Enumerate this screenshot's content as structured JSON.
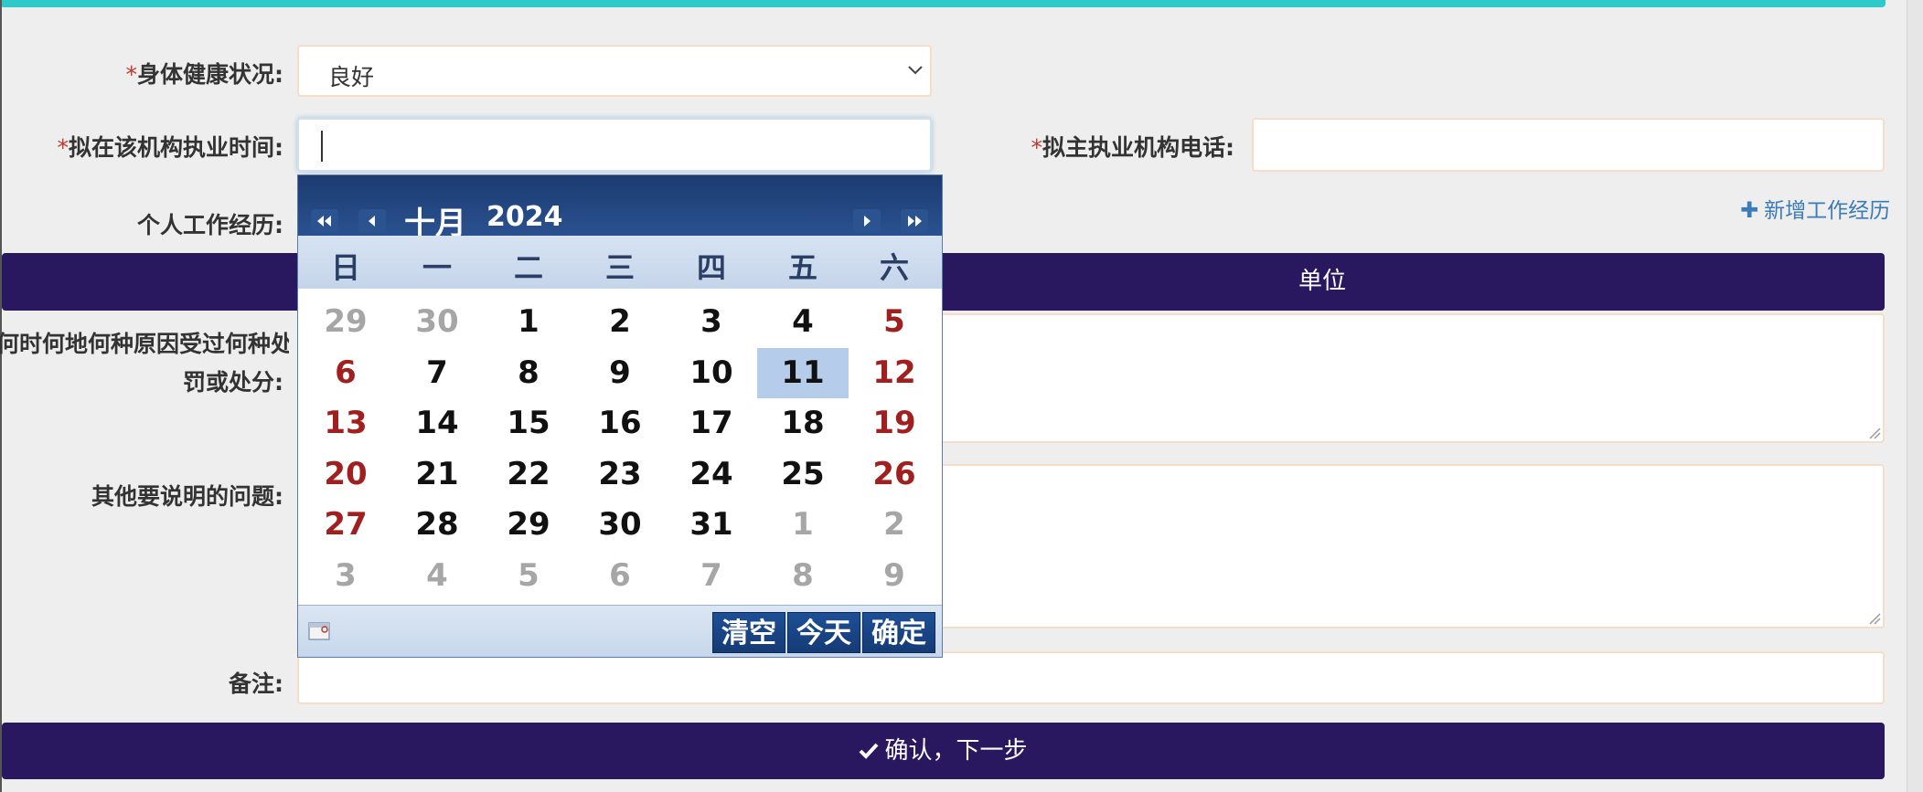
{
  "form": {
    "health": {
      "req": "*",
      "label": "身体健康状况:",
      "value": "良好"
    },
    "practice_time": {
      "req": "*",
      "label": "拟在该机构执业时间:"
    },
    "main_phone": {
      "req": "*",
      "label": "拟主执业机构电话:"
    },
    "work_history": {
      "label": "个人工作经历:",
      "add_link": "新增工作经历",
      "table_header": "单位"
    },
    "punishment": {
      "label_line1": "何时何地何种原因受过何种处",
      "label_line2": "罚或处分:"
    },
    "other_issues": {
      "label": "其他要说明的问题:"
    },
    "remark": {
      "label": "备注:"
    },
    "submit_label": "确认，下一步"
  },
  "calendar": {
    "month": "十月",
    "year": "2024",
    "weekdays": [
      "日",
      "一",
      "二",
      "三",
      "四",
      "五",
      "六"
    ],
    "weeks": [
      [
        "29",
        "30",
        "1",
        "2",
        "3",
        "4",
        "5"
      ],
      [
        "6",
        "7",
        "8",
        "9",
        "10",
        "11",
        "12"
      ],
      [
        "13",
        "14",
        "15",
        "16",
        "17",
        "18",
        "19"
      ],
      [
        "20",
        "21",
        "22",
        "23",
        "24",
        "25",
        "26"
      ],
      [
        "27",
        "28",
        "29",
        "30",
        "31",
        "1",
        "2"
      ],
      [
        "3",
        "4",
        "5",
        "6",
        "7",
        "8",
        "9"
      ]
    ],
    "selected": "11",
    "buttons": {
      "clear": "清空",
      "today": "今天",
      "ok": "确定"
    }
  },
  "colors": {
    "accent_top": "#2ec9c9",
    "navy": "#291760",
    "required": "#c0392b",
    "weekend": "#a01f1f",
    "link": "#3b7bb8"
  }
}
